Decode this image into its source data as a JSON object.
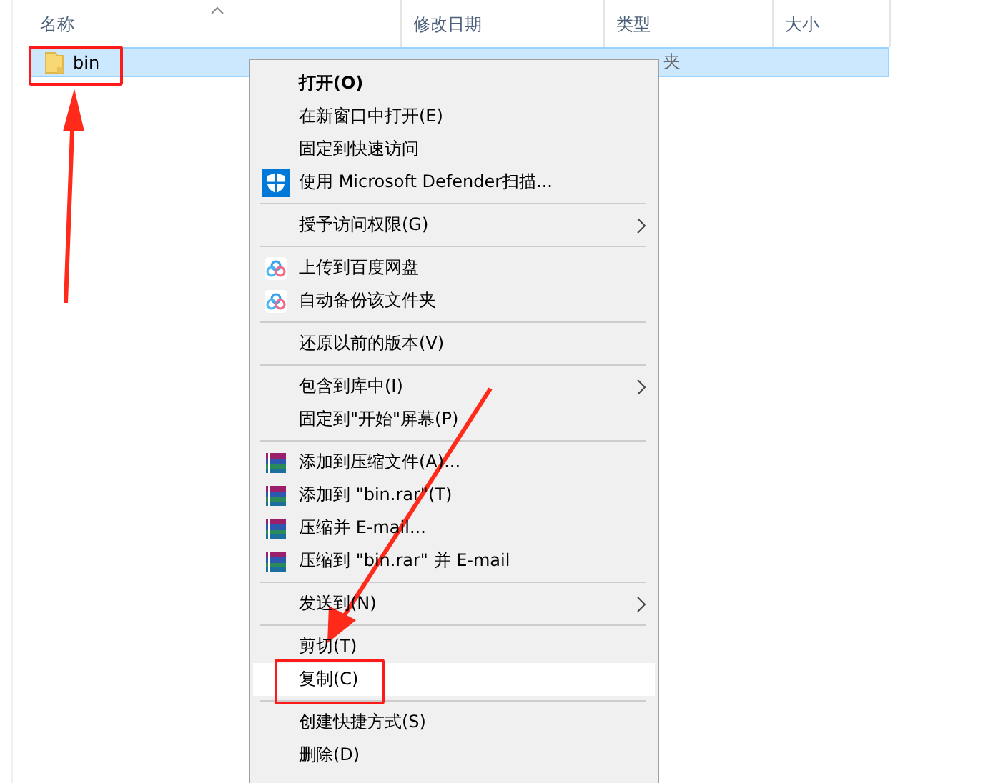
{
  "columns": [
    {
      "label": "名称",
      "sorted": true
    },
    {
      "label": "修改日期",
      "sorted": false
    },
    {
      "label": "类型",
      "sorted": false
    },
    {
      "label": "大小",
      "sorted": false
    }
  ],
  "rows": [
    {
      "name": "bin",
      "type": "夹",
      "selected": true
    }
  ],
  "context_menu": {
    "groups": [
      [
        {
          "label": "打开(O)",
          "bold": true,
          "kind": "plain",
          "submenu": false,
          "selected": false
        },
        {
          "label": "在新窗口中打开(E)",
          "bold": false,
          "kind": "plain",
          "submenu": false,
          "selected": false
        },
        {
          "label": "固定到快速访问",
          "bold": false,
          "kind": "plain",
          "submenu": false,
          "selected": false
        },
        {
          "label": "使用 Microsoft Defender扫描...",
          "bold": false,
          "kind": "shield",
          "submenu": false,
          "selected": false
        }
      ],
      [
        {
          "label": "授予访问权限(G)",
          "bold": false,
          "kind": "plain",
          "submenu": true,
          "selected": false
        }
      ],
      [
        {
          "label": "上传到百度网盘",
          "bold": false,
          "kind": "cloud",
          "submenu": false,
          "selected": false
        },
        {
          "label": "自动备份该文件夹",
          "bold": false,
          "kind": "cloud",
          "submenu": false,
          "selected": false
        }
      ],
      [
        {
          "label": "还原以前的版本(V)",
          "bold": false,
          "kind": "plain",
          "submenu": false,
          "selected": false
        }
      ],
      [
        {
          "label": "包含到库中(I)",
          "bold": false,
          "kind": "plain",
          "submenu": true,
          "selected": false
        },
        {
          "label": "固定到\"开始\"屏幕(P)",
          "bold": false,
          "kind": "plain",
          "submenu": false,
          "selected": false
        }
      ],
      [
        {
          "label": "添加到压缩文件(A)...",
          "bold": false,
          "kind": "archive",
          "submenu": false,
          "selected": false
        },
        {
          "label": "添加到 \"bin.rar\"(T)",
          "bold": false,
          "kind": "archive",
          "submenu": false,
          "selected": false
        },
        {
          "label": "压缩并 E-mail...",
          "bold": false,
          "kind": "archive",
          "submenu": false,
          "selected": false
        },
        {
          "label": "压缩到 \"bin.rar\" 并 E-mail",
          "bold": false,
          "kind": "archive",
          "submenu": false,
          "selected": false
        }
      ],
      [
        {
          "label": "发送到(N)",
          "bold": false,
          "kind": "plain",
          "submenu": true,
          "selected": false
        }
      ],
      [
        {
          "label": "剪切(T)",
          "bold": false,
          "kind": "plain",
          "submenu": false,
          "selected": false
        },
        {
          "label": "复制(C)",
          "bold": false,
          "kind": "plain",
          "submenu": false,
          "selected": true
        }
      ],
      [
        {
          "label": "创建快捷方式(S)",
          "bold": false,
          "kind": "plain",
          "submenu": false,
          "selected": false
        },
        {
          "label": "删除(D)",
          "bold": false,
          "kind": "plain",
          "submenu": false,
          "selected": false
        }
      ]
    ]
  }
}
